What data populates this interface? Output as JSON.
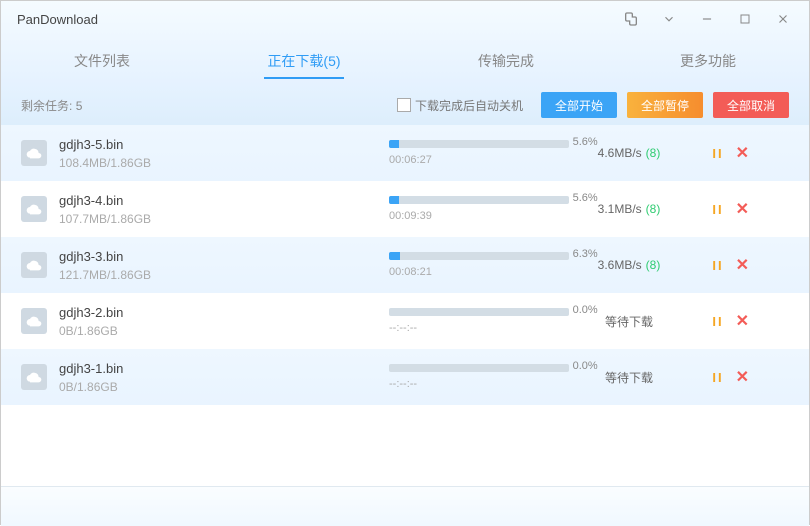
{
  "title": "PanDownload",
  "tabs": [
    {
      "label": "文件列表"
    },
    {
      "label": "正在下载(5)",
      "active": true
    },
    {
      "label": "传输完成"
    },
    {
      "label": "更多功能"
    }
  ],
  "toolbar": {
    "remaining_label": "剩余任务:",
    "remaining_count": "5",
    "shutdown_label": "下载完成后自动关机",
    "start_all": "全部开始",
    "pause_all": "全部暂停",
    "cancel_all": "全部取消"
  },
  "files": [
    {
      "name": "gdjh3-5.bin",
      "size": "108.4MB/1.86GB",
      "pct": "5.6%",
      "fill": 5.6,
      "time": "00:06:27",
      "speed": "4.6MB/s",
      "threads": "(8)"
    },
    {
      "name": "gdjh3-4.bin",
      "size": "107.7MB/1.86GB",
      "pct": "5.6%",
      "fill": 5.6,
      "time": "00:09:39",
      "speed": "3.1MB/s",
      "threads": "(8)"
    },
    {
      "name": "gdjh3-3.bin",
      "size": "121.7MB/1.86GB",
      "pct": "6.3%",
      "fill": 6.3,
      "time": "00:08:21",
      "speed": "3.6MB/s",
      "threads": "(8)"
    },
    {
      "name": "gdjh3-2.bin",
      "size": "0B/1.86GB",
      "pct": "0.0%",
      "fill": 0,
      "time": "--:--:--",
      "speed": "等待下载",
      "threads": ""
    },
    {
      "name": "gdjh3-1.bin",
      "size": "0B/1.86GB",
      "pct": "0.0%",
      "fill": 0,
      "time": "--:--:--",
      "speed": "等待下载",
      "threads": ""
    }
  ]
}
